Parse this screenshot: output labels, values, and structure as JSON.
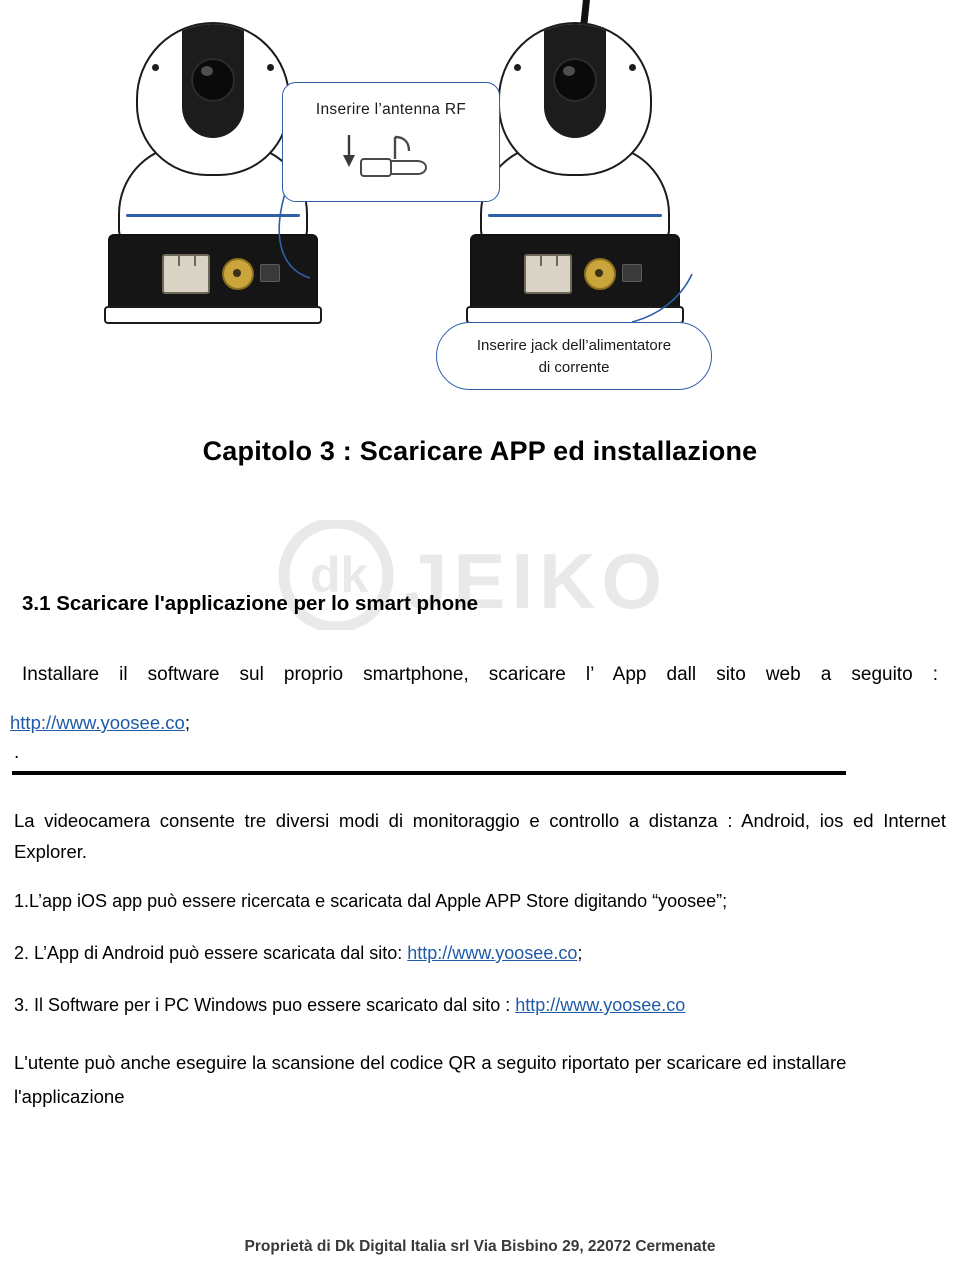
{
  "illustration": {
    "callout_rf": "Inserire l’antenna RF",
    "callout_power_line1": "Inserire jack  dell’alimentatore",
    "callout_power_line2": "di corrente",
    "camera_left_name": "camera-without-antenna",
    "camera_right_name": "camera-with-antenna"
  },
  "document": {
    "chapter_title": "Capitolo 3 :   Scaricare APP ed installazione",
    "section_title": "3.1 Scaricare l'applicazione per lo smart phone",
    "install_paragraph": "Installare il software sul proprio smartphone, scaricare l’ App dall sito web a seguito :",
    "url_main": "http://www.yoosee.co",
    "url_main_suffix": ";",
    "stray_dot": ".",
    "modes_paragraph": "La videocamera consente tre diversi modi di monitoraggio e controllo a distanza : Android, ios ed Internet Explorer.",
    "item1_text": "1.L’app iOS app può essere ricercata e scaricata dal Apple APP Store digitando    “yoosee”;",
    "item2_prefix": "2. L’App di Android    può essere scaricata dal sito: ",
    "item2_link": "http://www.yoosee.co",
    "item2_suffix": ";",
    "item3_prefix": "3. Il Software per i PC    Windows puo essere scaricato dal sito : ",
    "item3_link": "http://www.yoosee.co",
    "qr_paragraph_line1": "L'utente può anche eseguire la scansione del codice QR a seguito riportato per scaricare ed installare",
    "qr_paragraph_line2": "l'applicazione",
    "footer": "Proprietà di Dk Digital Italia srl Via Bisbino 29, 22072 Cermenate",
    "watermark_text": "JEIKO",
    "watermark_prefix": "dk"
  },
  "colors": {
    "link": "#1f5aa8",
    "callout_border": "#2f5fa8",
    "rule": "#000000",
    "watermark": "#b9b9b9"
  }
}
